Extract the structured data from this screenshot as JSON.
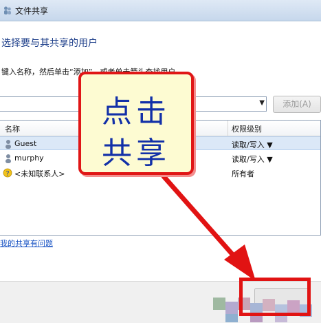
{
  "window": {
    "title": "文件共享"
  },
  "heading": "选择要与其共享的用户",
  "instruction": "键入名称，然后单击“添加”，或者单击箭头查找用户。",
  "add_button": {
    "label": "添加(A)"
  },
  "table": {
    "columns": {
      "name": "名称",
      "permission": "权限级别"
    },
    "rows": [
      {
        "name": "Guest",
        "permission": "读取/写入 ▼",
        "icon": "user-icon"
      },
      {
        "name": "murphy",
        "permission": "读取/写入 ▼",
        "icon": "user-icon"
      },
      {
        "name": "<未知联系人>",
        "permission": "所有者",
        "icon": "unknown-contact-icon"
      }
    ]
  },
  "help_link": "我的共享有问题",
  "callout": {
    "line1": "点击",
    "line2": "共享"
  },
  "colors": {
    "accent": "#1230a8",
    "annotation_red": "#e11313",
    "callout_bg": "#fdfbd2"
  }
}
